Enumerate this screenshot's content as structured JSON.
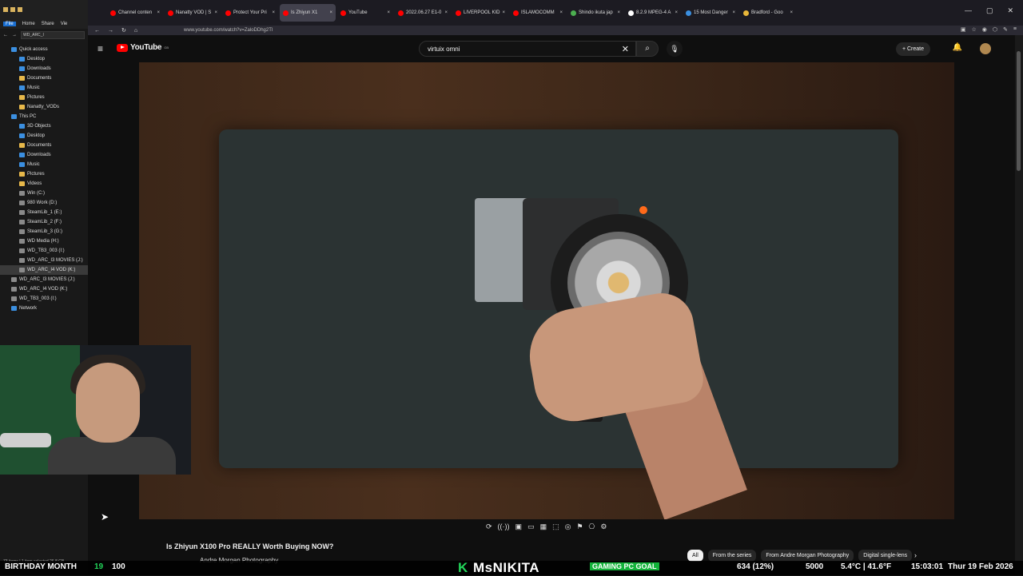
{
  "explorer": {
    "menu": [
      "File",
      "Home",
      "Share",
      "Vie"
    ],
    "path": "WD_ARC_I",
    "items": [
      {
        "label": "Quick access",
        "type": "blue",
        "indent": 0
      },
      {
        "label": "Desktop",
        "type": "blue",
        "indent": 1
      },
      {
        "label": "Downloads",
        "type": "blue",
        "indent": 1
      },
      {
        "label": "Documents",
        "type": "folder",
        "indent": 1
      },
      {
        "label": "Music",
        "type": "blue",
        "indent": 1
      },
      {
        "label": "Pictures",
        "type": "folder",
        "indent": 1
      },
      {
        "label": "Nanatty_VODs",
        "type": "folder",
        "indent": 1
      },
      {
        "label": "This PC",
        "type": "blue",
        "indent": 0
      },
      {
        "label": "3D Objects",
        "type": "blue",
        "indent": 1
      },
      {
        "label": "Desktop",
        "type": "blue",
        "indent": 1
      },
      {
        "label": "Documents",
        "type": "folder",
        "indent": 1
      },
      {
        "label": "Downloads",
        "type": "blue",
        "indent": 1
      },
      {
        "label": "Music",
        "type": "blue",
        "indent": 1
      },
      {
        "label": "Pictures",
        "type": "folder",
        "indent": 1
      },
      {
        "label": "Videos",
        "type": "folder",
        "indent": 1
      },
      {
        "label": "Win (C:)",
        "type": "drive",
        "indent": 1
      },
      {
        "label": "980 Work (D:)",
        "type": "drive",
        "indent": 1
      },
      {
        "label": "SteamLib_1 (E:)",
        "type": "drive",
        "indent": 1
      },
      {
        "label": "SteamLib_2 (F:)",
        "type": "drive",
        "indent": 1
      },
      {
        "label": "SteamLib_3 (G:)",
        "type": "drive",
        "indent": 1
      },
      {
        "label": "WD Media (H:)",
        "type": "drive",
        "indent": 1
      },
      {
        "label": "WD_TB3_003 (I:)",
        "type": "drive",
        "indent": 1
      },
      {
        "label": "WD_ARC_I3 MOVIES (J:)",
        "type": "drive",
        "indent": 1
      },
      {
        "label": "WD_ARC_I4 VOD (K:)",
        "type": "drive",
        "indent": 1,
        "selected": true
      },
      {
        "label": "WD_ARC_I3 MOVIES (J:)",
        "type": "drive",
        "indent": 0
      },
      {
        "label": "WD_ARC_I4 VOD (K:)",
        "type": "drive",
        "indent": 0
      },
      {
        "label": "WD_TB3_003 (I:)",
        "type": "drive",
        "indent": 0
      },
      {
        "label": "Network",
        "type": "blue",
        "indent": 0
      }
    ],
    "status": "73 items | 1 item selected 26.8 GB"
  },
  "browser": {
    "tabs": [
      {
        "label": "Channel conten",
        "color": "#ff0000"
      },
      {
        "label": "Nanatty VOD | S",
        "color": "#ff0000"
      },
      {
        "label": "Protect Your Pri",
        "color": "#ff0000"
      },
      {
        "label": "Is Zhiyun X1",
        "color": "#ff0000",
        "active": true
      },
      {
        "label": "YouTube",
        "color": "#ff0000"
      },
      {
        "label": "2022.06.27 E1-0",
        "color": "#ff0000"
      },
      {
        "label": "LIVERPOOL KID",
        "color": "#ff0000"
      },
      {
        "label": "ISLAMOCOMM",
        "color": "#ff0000"
      },
      {
        "label": "Shindo ikuta jap",
        "color": "#4caf50"
      },
      {
        "label": "8.2.9 MPEG-4 A",
        "color": "#ffffff"
      },
      {
        "label": "15 Most Danger",
        "color": "#3b8fe0"
      },
      {
        "label": "Bradford - Goo",
        "color": "#e8b73a"
      }
    ],
    "url": "www.youtube.com/watch?v=ZaloDDhg2Tl",
    "window_controls": [
      "—",
      "▢",
      "✕"
    ]
  },
  "youtube": {
    "logo": "YouTube",
    "country_code": "GB",
    "search_query": "virtuix omni",
    "create_label": "Create",
    "video_title": "Is Zhiyun X100 Pro REALLY Worth Buying NOW?",
    "channel": "Andre Morgan Photography",
    "chips": [
      {
        "label": "All",
        "selected": true
      },
      {
        "label": "From the series"
      },
      {
        "label": "From Andre Morgan Photography"
      },
      {
        "label": "Digital single-lens"
      }
    ],
    "player_controls": [
      "⟳",
      "((·))",
      "▣",
      "▭",
      "▦",
      "⬚",
      "◎",
      "⚑",
      "⎔",
      "⚙"
    ]
  },
  "ticker": {
    "left": "BIRTHDAY MONTH",
    "count": "19",
    "percent": "100",
    "brand_k": "K",
    "brand": "MsNIKITA",
    "goal": "GAMING PC GOAL",
    "goal_progress": "634 (12%)",
    "goal_target": "5000",
    "weather": "5.4°C | 41.6°F",
    "time": "15:03:01",
    "date": "Thur 19 Feb 2026"
  }
}
